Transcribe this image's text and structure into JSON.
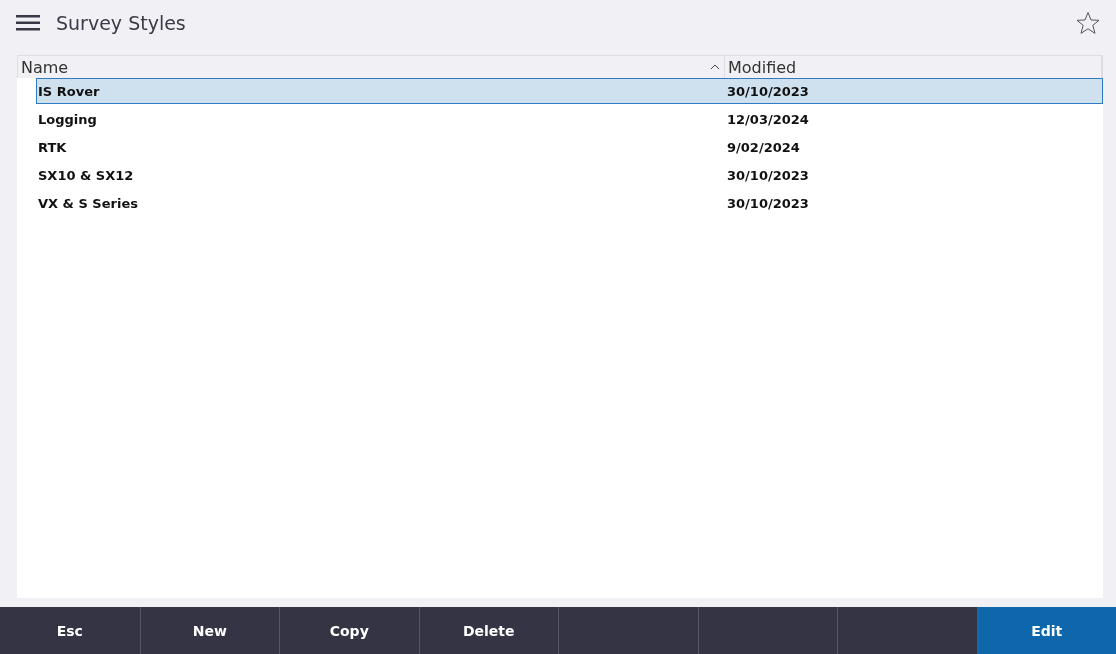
{
  "header": {
    "title": "Survey Styles"
  },
  "table": {
    "columns": [
      {
        "label": "Name",
        "sorted": true
      },
      {
        "label": "Modified",
        "sorted": false
      }
    ],
    "rows": [
      {
        "name": "IS Rover",
        "modified": "30/10/2023",
        "selected": true
      },
      {
        "name": "Logging",
        "modified": "12/03/2024",
        "selected": false
      },
      {
        "name": "RTK",
        "modified": "9/02/2024",
        "selected": false
      },
      {
        "name": "SX10 & SX12",
        "modified": "30/10/2023",
        "selected": false
      },
      {
        "name": "VX & S Series",
        "modified": "30/10/2023",
        "selected": false
      }
    ]
  },
  "buttons": [
    {
      "kind": "action",
      "label": "Esc"
    },
    {
      "kind": "action",
      "label": "New"
    },
    {
      "kind": "action",
      "label": "Copy"
    },
    {
      "kind": "action",
      "label": "Delete"
    },
    {
      "kind": "empty"
    },
    {
      "kind": "empty"
    },
    {
      "kind": "empty"
    },
    {
      "kind": "primary",
      "label": "Edit"
    }
  ]
}
